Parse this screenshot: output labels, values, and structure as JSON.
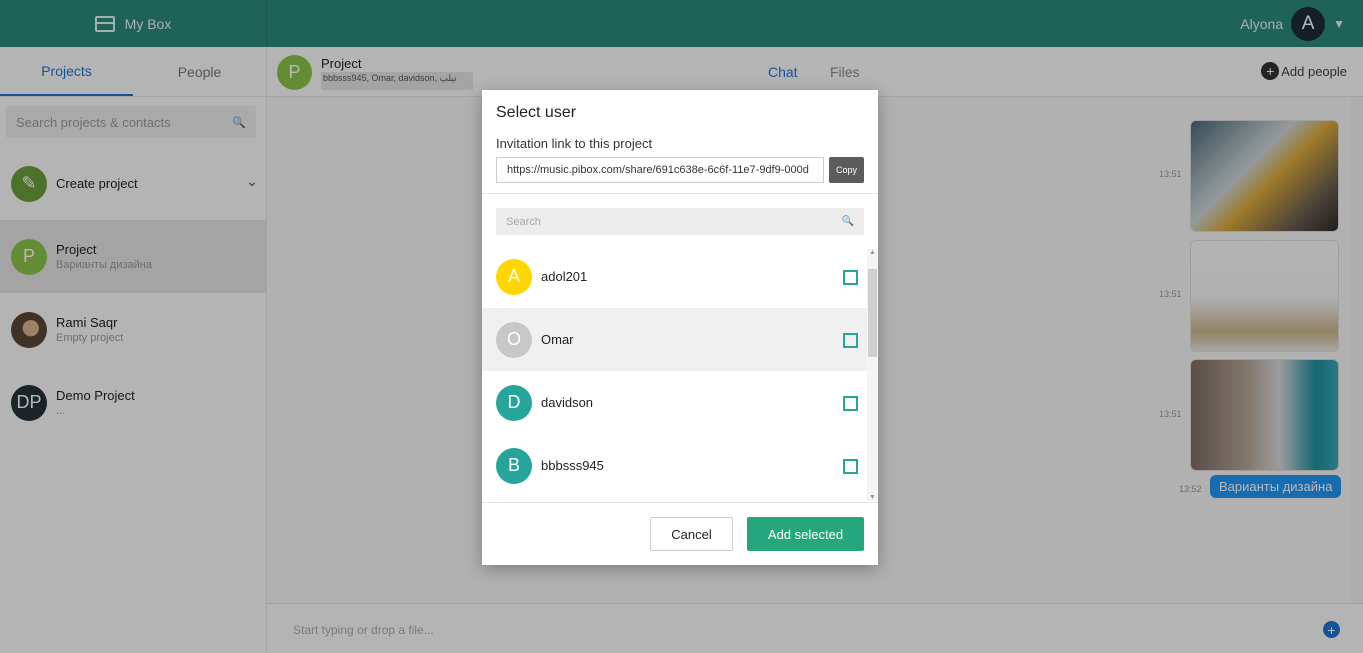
{
  "app": {
    "title": "My Box",
    "user_name": "Alyona",
    "user_initial": "A"
  },
  "sidebar": {
    "tabs": [
      "Projects",
      "People"
    ],
    "search_placeholder": "Search projects & contacts",
    "items": [
      {
        "title": "Create project",
        "subtitle": ""
      },
      {
        "title": "Project",
        "subtitle": "Варианты дизайна",
        "initial": "P"
      },
      {
        "title": "Rami Saqr",
        "subtitle": "Empty project"
      },
      {
        "title": "Demo Project",
        "subtitle": "...",
        "initial": "DP"
      }
    ]
  },
  "header": {
    "project_title": "Project",
    "members": "bbbsss945, Omar, davidson, تيلب",
    "tabs": [
      "Chat",
      "Files"
    ],
    "add_people": "Add people",
    "project_initial": "P"
  },
  "chat": {
    "times": [
      "13:51",
      "13:51",
      "13:51",
      "13:52"
    ],
    "message": "Варианты дизайна",
    "input_placeholder": "Start typing or drop a file..."
  },
  "modal": {
    "title": "Select user",
    "invitation_label": "Invitation link to this project",
    "link": "https://music.pibox.com/share/691c638e-6c6f-11e7-9df9-000d",
    "copy_label": "Copy",
    "search_placeholder": "Search",
    "users": [
      {
        "initial": "A",
        "name": "adol201",
        "color": "#ffd600"
      },
      {
        "initial": "O",
        "name": "Omar",
        "color": "#c7c7c7"
      },
      {
        "initial": "D",
        "name": "davidson",
        "color": "#26a69a"
      },
      {
        "initial": "B",
        "name": "bbbsss945",
        "color": "#26a69a"
      }
    ],
    "cancel_label": "Cancel",
    "add_label": "Add selected"
  },
  "colors": {
    "teal": "#2c8a7b",
    "accent_blue": "#1976d2",
    "add_green": "#26a67d"
  }
}
